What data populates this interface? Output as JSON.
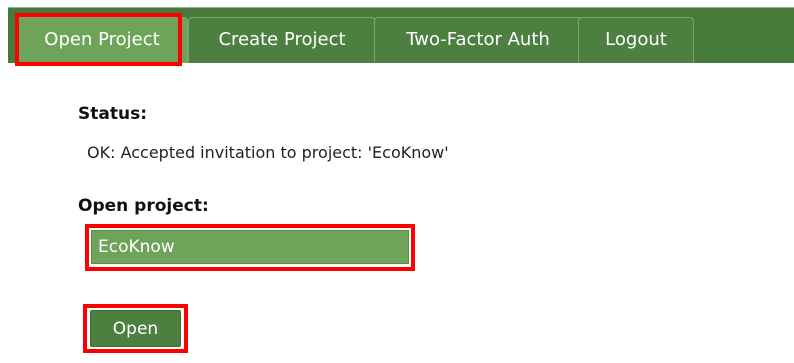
{
  "nav": {
    "tabs": [
      {
        "label": "Open Project",
        "active": true
      },
      {
        "label": "Create Project",
        "active": false
      },
      {
        "label": "Two-Factor Auth",
        "active": false
      },
      {
        "label": "Logout",
        "active": false
      }
    ]
  },
  "status": {
    "label": "Status:",
    "text": "OK: Accepted invitation to project: 'EcoKnow'"
  },
  "open_project": {
    "label": "Open project:",
    "input_value": "EcoKnow",
    "button_label": "Open"
  },
  "colors": {
    "nav_background": "#467a3a",
    "tab_background": "#4d8040",
    "active_tab_background": "#6ea35a",
    "input_background": "#6ea35a",
    "highlight": "#ff0000"
  }
}
